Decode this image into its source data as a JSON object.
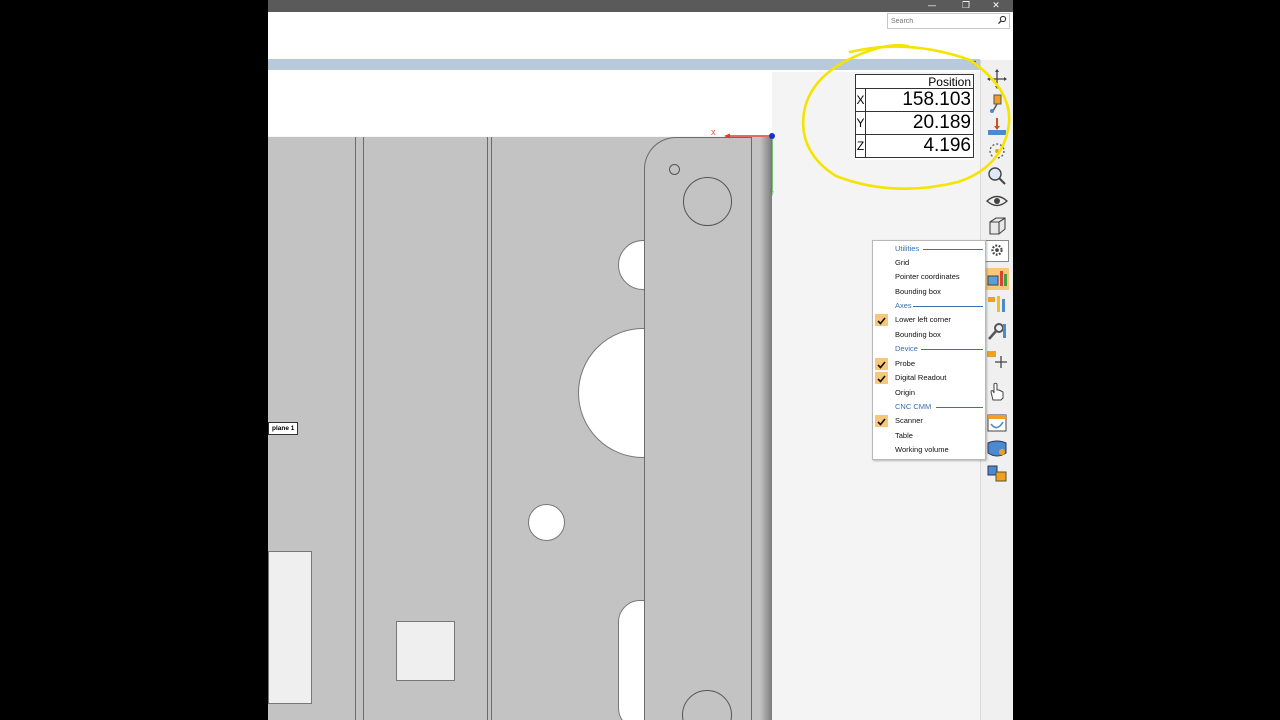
{
  "window": {
    "controls": {
      "minimize": "—",
      "restore": "❐",
      "close": "✕"
    }
  },
  "search": {
    "placeholder": "Search"
  },
  "viewport": {
    "plane_label": "plane 1",
    "axes": {
      "x": "X",
      "y": "Y"
    }
  },
  "readout": {
    "header": "Position",
    "rows": [
      {
        "axis": "X",
        "value": "158.103"
      },
      {
        "axis": "Y",
        "value": "20.189"
      },
      {
        "axis": "Z",
        "value": "4.196"
      }
    ]
  },
  "menu": {
    "sections": {
      "utilities": "Utilities",
      "axes": "Axes",
      "device": "Device",
      "cnc_cmm": "CNC CMM"
    },
    "items": {
      "grid": {
        "label": "Grid",
        "checked": false
      },
      "pointer_coordinates": {
        "label": "Pointer coordinates",
        "checked": false
      },
      "bounding_box_utilities": {
        "label": "Bounding box",
        "checked": false
      },
      "lower_left_corner": {
        "label": "Lower left corner",
        "checked": true
      },
      "bounding_box_axes": {
        "label": "Bounding box",
        "checked": false
      },
      "probe": {
        "label": "Probe",
        "checked": true
      },
      "digital_readout": {
        "label": "Digital Readout",
        "checked": true
      },
      "origin": {
        "label": "Origin",
        "checked": false
      },
      "scanner": {
        "label": "Scanner",
        "checked": true
      },
      "table": {
        "label": "Table",
        "checked": false
      },
      "working_volume": {
        "label": "Working volume",
        "checked": false
      }
    }
  },
  "colors": {
    "accent_highlight": "#f7c87a",
    "annotation": "#f5e400",
    "section_blue": "#3a6fb0",
    "axis_x": "#e23a2a",
    "axis_y": "#2aa02a",
    "axis_z": "#1a2fd0"
  },
  "icons": {
    "toolbar": [
      "move-icon",
      "probe-icon",
      "pick-icon",
      "circle-select-icon",
      "zoom-icon",
      "eye-icon",
      "cube-view-icon",
      "gear-icon",
      "display-settings-icon",
      "color-bars-icon",
      "wrench-icon",
      "move-probe-icon",
      "hand-icon",
      "dialog-icon",
      "surface-icon",
      "transform-icon"
    ]
  }
}
